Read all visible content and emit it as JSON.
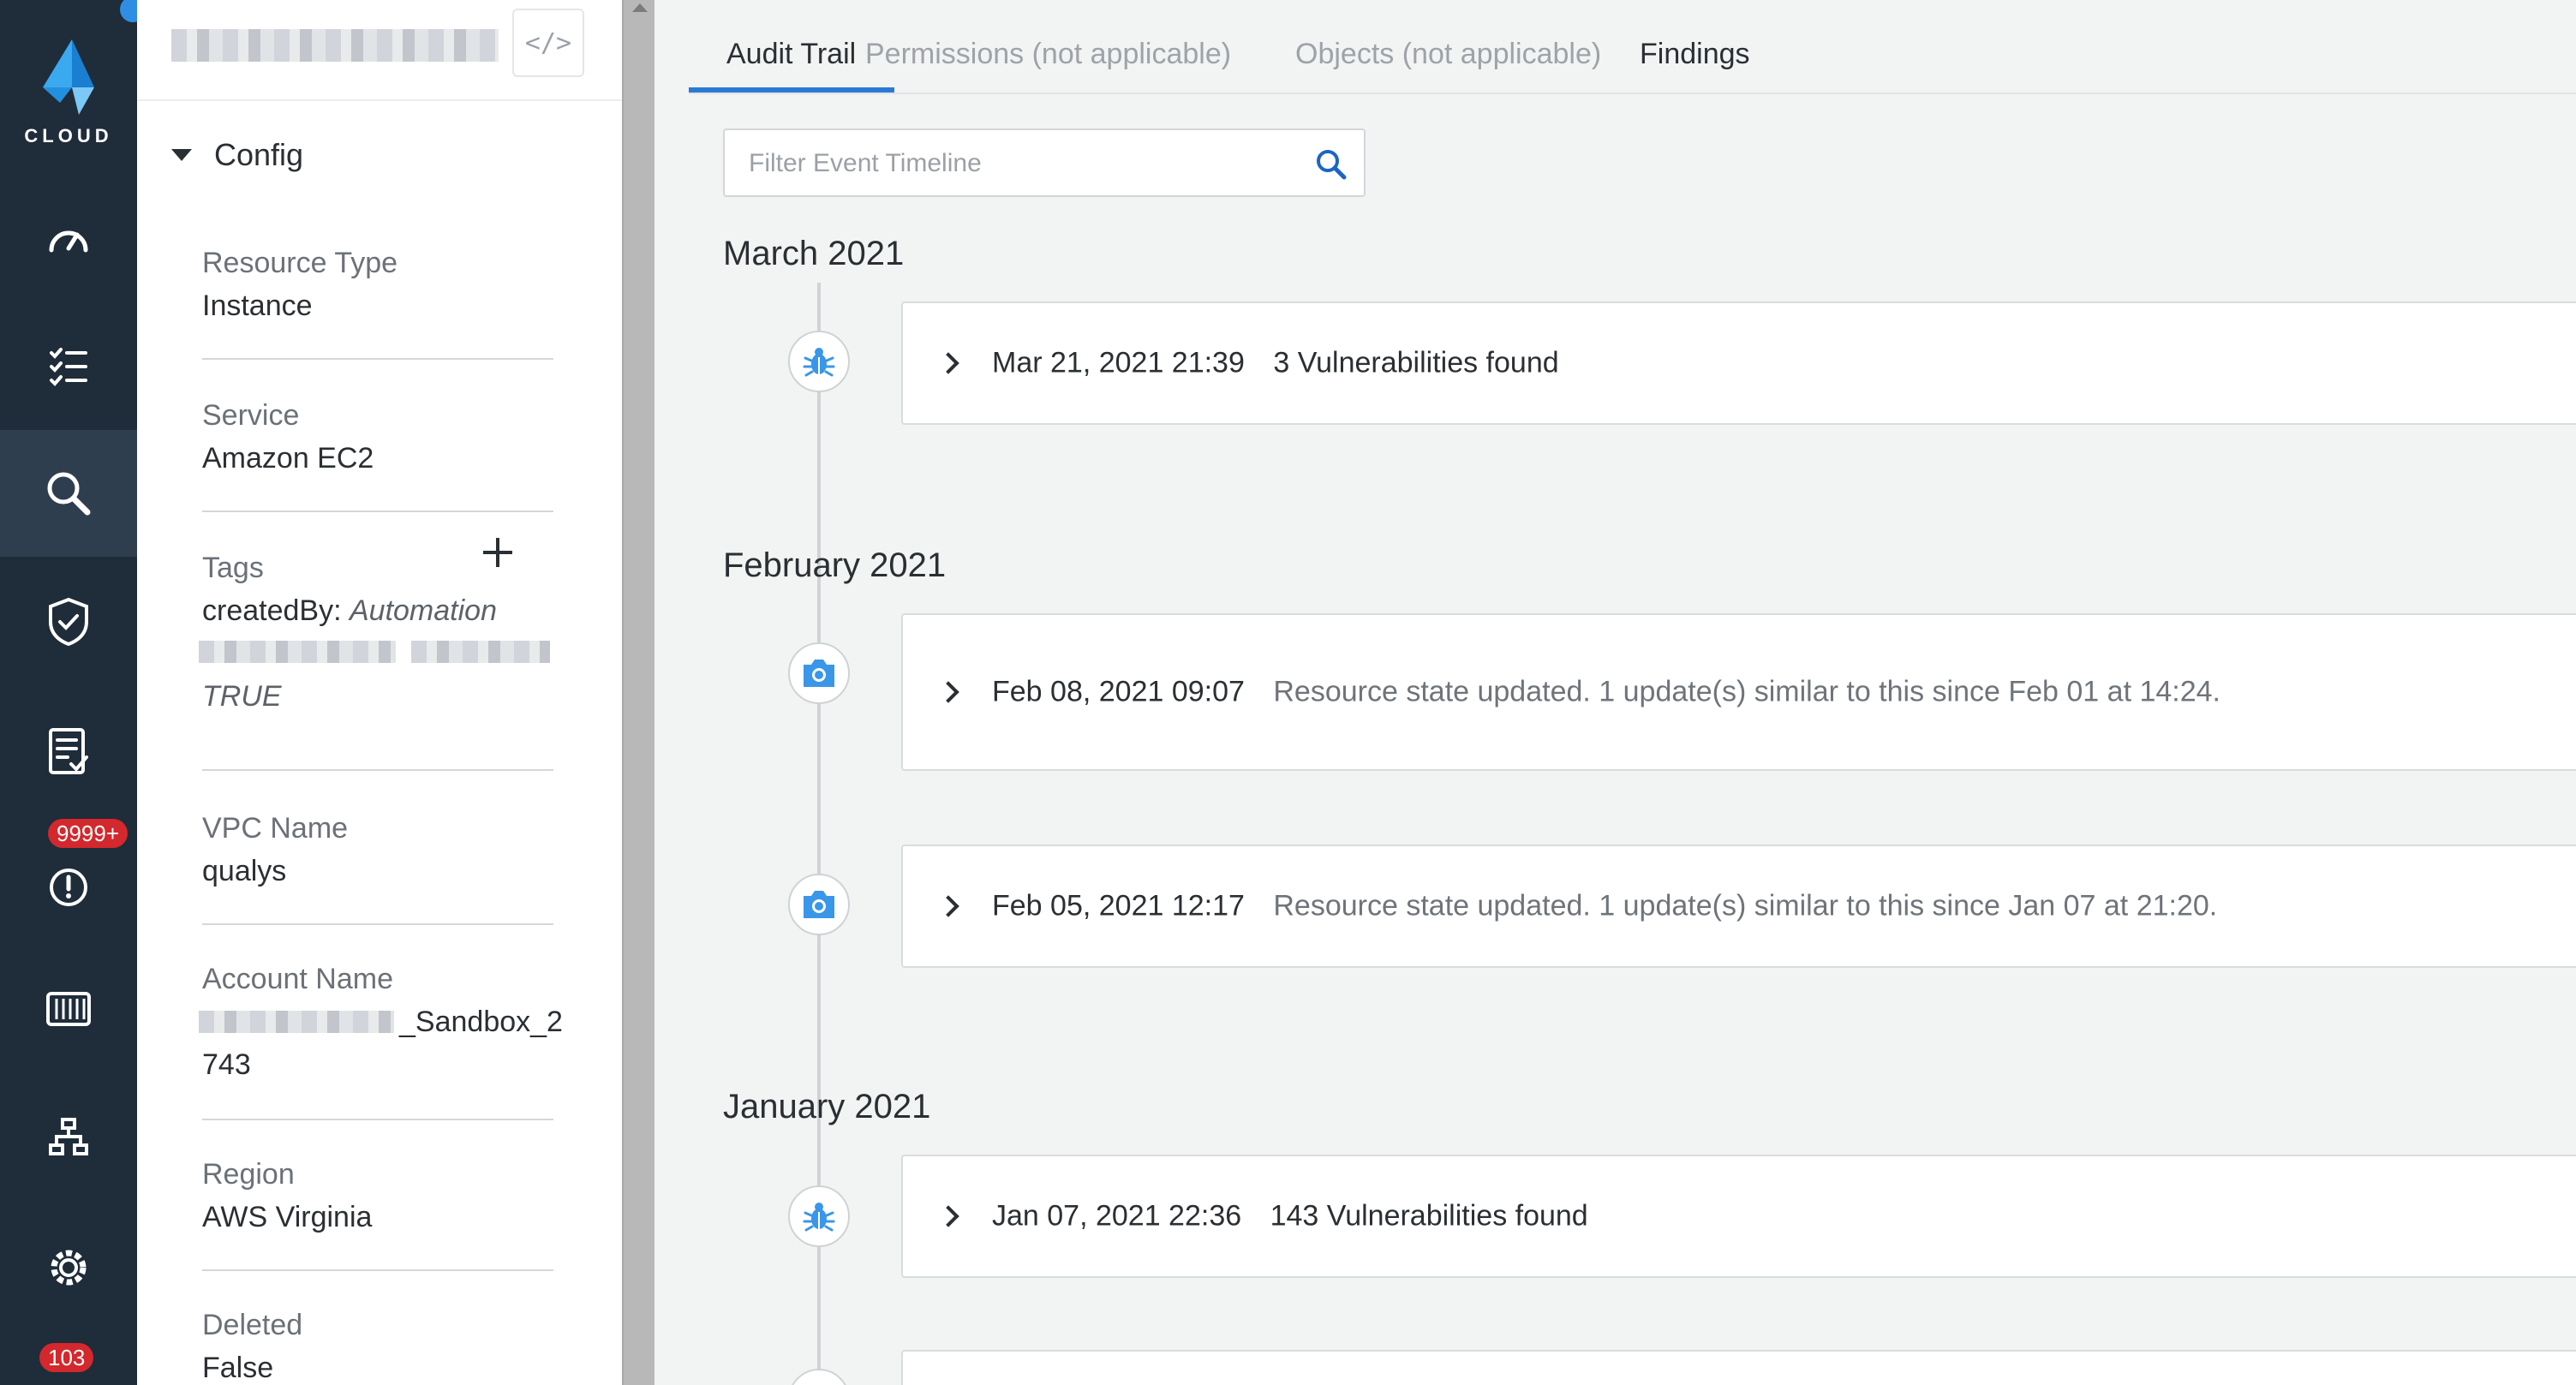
{
  "nav": {
    "brand_label": "CLOUD",
    "items": [
      {
        "icon": "speedometer-icon"
      },
      {
        "icon": "checklist-icon"
      },
      {
        "icon": "search-icon"
      },
      {
        "icon": "shield-check-icon"
      },
      {
        "icon": "report-icon"
      },
      {
        "icon": "alert-icon",
        "badge": "9999+"
      },
      {
        "icon": "container-icon"
      },
      {
        "icon": "network-icon"
      },
      {
        "icon": "settings-gear-icon"
      },
      {
        "icon": "user-icon",
        "badge": "103"
      }
    ],
    "accent": "#2f8de4",
    "badge_color": "#d3282d"
  },
  "config": {
    "section_title": "Config",
    "code_button": "</>",
    "fields": {
      "resource_type": {
        "label": "Resource Type",
        "value": "Instance"
      },
      "service": {
        "label": "Service",
        "value": "Amazon EC2"
      },
      "tags": {
        "label": "Tags",
        "tag_key": "createdBy:",
        "tag_value": "Automation",
        "second_value": "TRUE"
      },
      "vpc_name": {
        "label": "VPC Name",
        "value": "qualys"
      },
      "account_name": {
        "label": "Account Name",
        "value_suffix": "_Sandbox_2",
        "value_line2": "743"
      },
      "region": {
        "label": "Region",
        "value": "AWS Virginia"
      },
      "deleted": {
        "label": "Deleted",
        "value": "False"
      }
    }
  },
  "tabs": [
    {
      "label": "Audit Trail",
      "active": true
    },
    {
      "label": "Permissions (not applicable)",
      "disabled": true
    },
    {
      "label": "Objects (not applicable)",
      "disabled": true
    },
    {
      "label": "Findings"
    }
  ],
  "search": {
    "placeholder": "Filter Event Timeline"
  },
  "timeline": {
    "months": [
      "March 2021",
      "February 2021",
      "January 2021"
    ],
    "events": [
      {
        "timestamp": "Mar 21, 2021 21:39",
        "description": "3 Vulnerabilities found",
        "icon": "bug-icon"
      },
      {
        "timestamp": "Feb 08, 2021 09:07",
        "description": "Resource state updated. 1 update(s) similar to this since Feb 01 at 14:24.",
        "icon": "camera-icon"
      },
      {
        "timestamp": "Feb 05, 2021 12:17",
        "description": "Resource state updated. 1 update(s) similar to this since Jan 07 at 21:20.",
        "icon": "camera-icon"
      },
      {
        "timestamp": "Jan 07, 2021 22:36",
        "description": "143 Vulnerabilities found",
        "icon": "bug-icon"
      }
    ]
  },
  "colors": {
    "tab_active_underline": "#2a7ad5",
    "icon_blue": "#3a96e8"
  }
}
